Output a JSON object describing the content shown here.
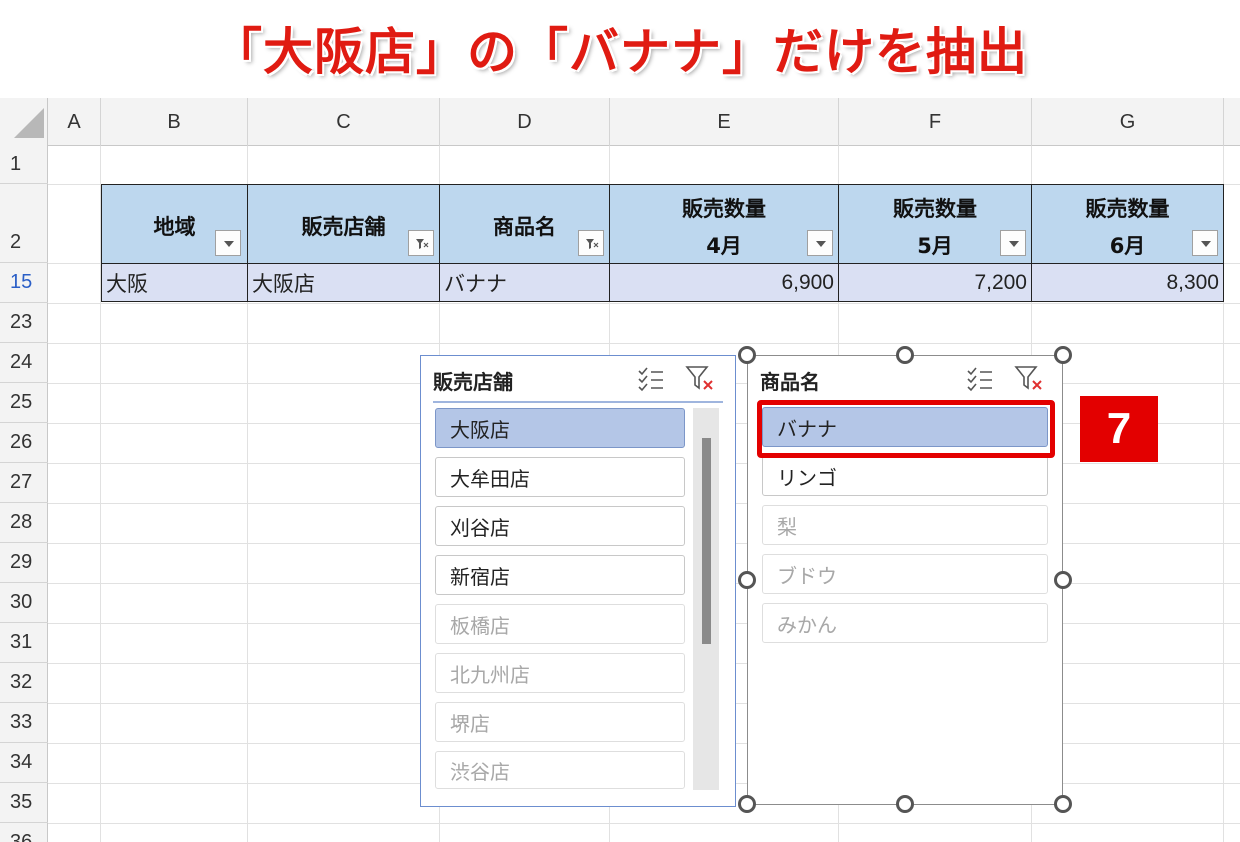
{
  "title": "「大阪店」の「バナナ」だけを抽出",
  "columns": [
    "A",
    "B",
    "C",
    "D",
    "E",
    "F",
    "G"
  ],
  "rows": [
    "1",
    "2",
    "15",
    "23",
    "24",
    "25",
    "26",
    "27",
    "28",
    "29",
    "30",
    "31",
    "32",
    "33",
    "34",
    "35",
    "36"
  ],
  "table": {
    "headers": [
      {
        "line1": "地域",
        "line2": "",
        "filter": "none"
      },
      {
        "line1": "販売店舗",
        "line2": "",
        "filter": "active"
      },
      {
        "line1": "商品名",
        "line2": "",
        "filter": "active"
      },
      {
        "line1": "販売数量",
        "line2": "4月",
        "filter": "none"
      },
      {
        "line1": "販売数量",
        "line2": "5月",
        "filter": "none"
      },
      {
        "line1": "販売数量",
        "line2": "6月",
        "filter": "none"
      }
    ],
    "row": [
      "大阪",
      "大阪店",
      "バナナ",
      "6,900",
      "7,200",
      "8,300"
    ]
  },
  "slicer_store": {
    "title": "販売店舗",
    "items": [
      {
        "label": "大阪店",
        "state": "selected"
      },
      {
        "label": "大牟田店",
        "state": "normal"
      },
      {
        "label": "刈谷店",
        "state": "normal"
      },
      {
        "label": "新宿店",
        "state": "normal"
      },
      {
        "label": "板橋店",
        "state": "dim"
      },
      {
        "label": "北九州店",
        "state": "dim"
      },
      {
        "label": "堺店",
        "state": "dim"
      },
      {
        "label": "渋谷店",
        "state": "dim"
      }
    ]
  },
  "slicer_product": {
    "title": "商品名",
    "items": [
      {
        "label": "バナナ",
        "state": "selected"
      },
      {
        "label": "リンゴ",
        "state": "normal"
      },
      {
        "label": "梨",
        "state": "dim"
      },
      {
        "label": "ブドウ",
        "state": "dim"
      },
      {
        "label": "みかん",
        "state": "dim"
      }
    ]
  },
  "step_badge": "7",
  "colors": {
    "title_red": "#e01b12",
    "header_fill": "#bdd7ee",
    "row_fill": "#dae0f3",
    "selected_item": "#b4c6e7",
    "highlight_red": "#e30000"
  },
  "icons": [
    "multi-select-icon",
    "clear-filter-icon",
    "dropdown-arrow-icon",
    "filter-applied-icon"
  ]
}
